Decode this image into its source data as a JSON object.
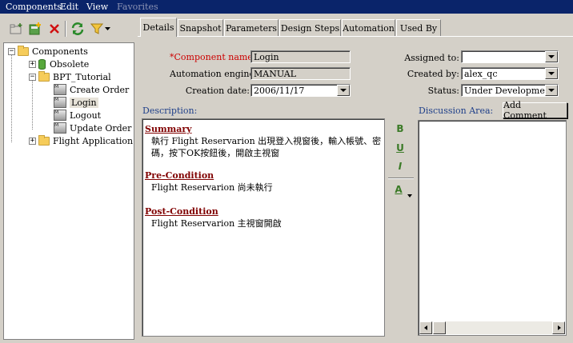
{
  "menu": {
    "items": [
      "Components",
      "Edit",
      "View",
      "Favorites"
    ]
  },
  "toolbar": {
    "icons": [
      "new-folder-icon",
      "new-component-icon",
      "delete-icon",
      "refresh-icon",
      "filter-icon",
      "chevron-down-icon"
    ]
  },
  "tree": {
    "root": "Components",
    "nodes": [
      "Obsolete",
      "BPT_Tutorial",
      "Create Order",
      "Login",
      "Logout",
      "Update Order",
      "Flight Application"
    ],
    "selected": "Login"
  },
  "tabs": [
    "Details",
    "Snapshot",
    "Parameters",
    "Design Steps",
    "Automation",
    "Used By"
  ],
  "active_tab": "Details",
  "form": {
    "component_name_label": "Component name:",
    "required_mark": "*",
    "component_name": "Login",
    "automation_engine_label": "Automation engine:",
    "automation_engine": "MANUAL",
    "creation_date_label": "Creation date:",
    "creation_date": "2006/11/17",
    "assigned_to_label": "Assigned to:",
    "assigned_to": "",
    "created_by_label": "Created by:",
    "created_by": "alex_qc",
    "status_label": "Status:",
    "status": "Under Development"
  },
  "description": {
    "label": "Description:",
    "summary_heading": "Summary",
    "summary_text": "執行 Flight Reservarion 出現登入視窗後，輸入帳號、密碼，按下OK按鈕後，開啟主視窗",
    "pre_heading": "Pre-Condition",
    "pre_text": "Flight Reservarion 尚未執行",
    "post_heading": "Post-Condition",
    "post_text": "Flight Reservarion 主視窗開啟"
  },
  "format_buttons": {
    "bold": "B",
    "underline": "U",
    "italic": "I",
    "font_color": "A"
  },
  "discussion": {
    "label": "Discussion Area:",
    "add_comment": "Add Comment"
  },
  "colors": {
    "menubar": "#0a246a",
    "required": "#cc0000",
    "heading": "#800000",
    "section_label": "#20408a"
  }
}
